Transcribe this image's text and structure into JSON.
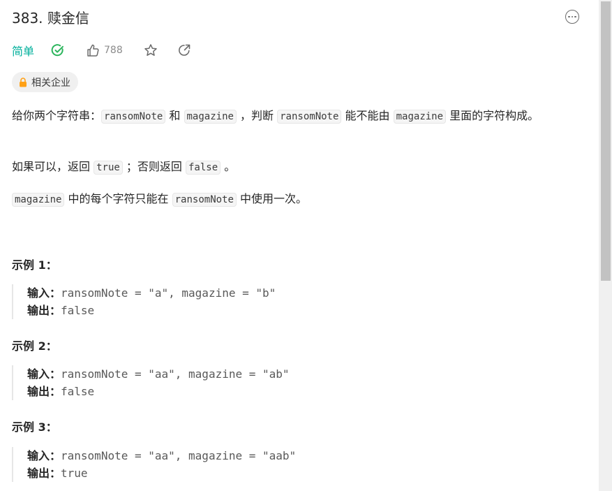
{
  "problem": {
    "title": "383. 赎金信",
    "difficulty": "简单",
    "likes": "788",
    "tag_label": "相关企业"
  },
  "description": {
    "p1": {
      "a": "给你两个字符串：",
      "c1": "ransomNote",
      "b": " 和 ",
      "c2": "magazine",
      "c": " ，判断 ",
      "c3": "ransomNote",
      "d": " 能不能由 ",
      "c4": "magazine",
      "e": " 里面的字符构成。"
    },
    "p2": {
      "a": "如果可以，返回 ",
      "c1": "true",
      "b": " ；否则返回 ",
      "c2": "false",
      "c": " 。"
    },
    "p3": {
      "c1": "magazine",
      "a": " 中的每个字符只能在 ",
      "c2": "ransomNote",
      "b": " 中使用一次。"
    }
  },
  "examples": [
    {
      "title": "示例 1：",
      "input_label": "输入：",
      "input": "ransomNote = \"a\", magazine = \"b\"",
      "output_label": "输出：",
      "output": "false"
    },
    {
      "title": "示例 2：",
      "input_label": "输入：",
      "input": "ransomNote = \"aa\", magazine = \"ab\"",
      "output_label": "输出：",
      "output": "false"
    },
    {
      "title": "示例 3：",
      "input_label": "输入：",
      "input": "ransomNote = \"aa\", magazine = \"aab\"",
      "output_label": "输出：",
      "output": "true"
    }
  ],
  "icons": {
    "more": "more-horizontal-icon",
    "solved": "check-circle-icon",
    "like": "thumbs-up-icon",
    "star": "star-icon",
    "share": "share-icon",
    "lock": "lock-icon"
  },
  "colors": {
    "easy": "#00af9b",
    "solved": "#2db55d",
    "lock": "#ffa116"
  }
}
